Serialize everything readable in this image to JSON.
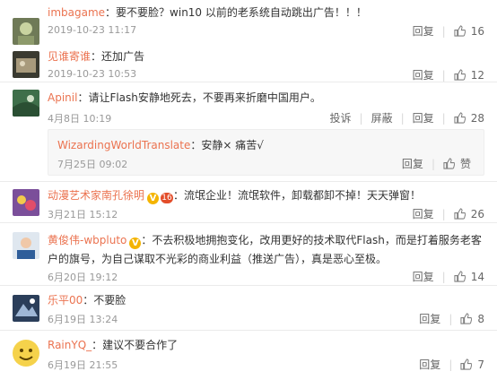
{
  "comments": [
    {
      "user": "imbagame",
      "text": "：要不要脸？win10 以前的老系统自动跳出广告！！！",
      "time": "2019-10-23 11:17",
      "reply": "回复",
      "likes": "16"
    },
    {
      "user": "见谁寄谁",
      "text": "：还加广告",
      "time": "2019-10-23 10:53",
      "reply": "回复",
      "likes": "12"
    },
    {
      "user": "Apinil",
      "text": "：请让Flash安静地死去，不要再来折磨中国用户。",
      "time": "4月8日 10:19",
      "report": "投诉",
      "block": "屏蔽",
      "reply": "回复",
      "likes": "28",
      "sub_reply": {
        "user": "WizardingWorldTranslate",
        "text": "：安静× 痛苦√",
        "time": "7月25日 09:02",
        "reply": "回复",
        "likes": "赞"
      }
    },
    {
      "user": "动漫艺术家南孔徐明",
      "badge": "V",
      "rank": "16",
      "text": "：流氓企业！流氓软件，卸载都卸不掉！天天弹窗！",
      "time": "3月21日 15:12",
      "reply": "回复",
      "likes": "26"
    },
    {
      "user": "黄俊伟-wbpluto",
      "badge": "V",
      "text": "：不去积极地拥抱变化，改用更好的技术取代Flash，而是打着服务老客户的旗号，为自己谋取不光彩的商业利益（推送广告），真是恶心至极。",
      "time": "6月20日 19:12",
      "reply": "回复",
      "likes": "14"
    },
    {
      "user": "乐平00",
      "text": "：不要脸",
      "time": "6月19日 13:24",
      "reply": "回复",
      "likes": "8"
    },
    {
      "user": "RainYQ_",
      "text": "：建议不要合作了",
      "time": "6月19日 21:55",
      "reply": "回复",
      "likes": "7"
    }
  ],
  "colors": {
    "username": "#eb7350",
    "meta": "#999999",
    "text": "#333333"
  }
}
